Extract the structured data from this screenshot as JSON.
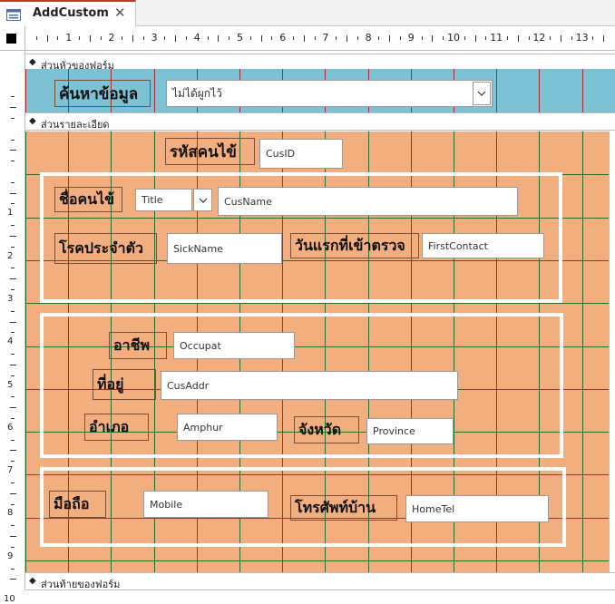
{
  "tab": {
    "title": "AddCustom",
    "close_glyph": "✕",
    "icon": "form-icon"
  },
  "ruler": {
    "h_numbers": [
      "1",
      "2",
      "3",
      "4",
      "5",
      "6",
      "7",
      "8",
      "9",
      "10",
      "11",
      "12",
      "13"
    ],
    "v_numbers": [
      "1",
      "2",
      "3",
      "4",
      "5",
      "6",
      "7",
      "8",
      "9",
      "10"
    ]
  },
  "sections": {
    "header": "ส่วนหัวของฟอร์ม",
    "detail": "ส่วนรายละเอียด",
    "footer": "ส่วนท้ายของฟอร์ม"
  },
  "header_controls": {
    "search_label": "ค้นหาข้อมูล",
    "search_combo_value": "ไม่ได้ผูกไว้"
  },
  "detail_controls": {
    "cusid_label": "รหัสคนไข้",
    "cusid_field": "CusID",
    "name_label": "ชื่อคนไข้",
    "title_combo": "Title",
    "cusname_field": "CusName",
    "sick_label": "โรคประจำตัว",
    "sickname_field": "SickName",
    "firstdate_label": "วันแรกที่เข้าตรวจ",
    "firstcontact_field": "FirstContact",
    "occupation_label": "อาชีพ",
    "occupat_field": "Occupat",
    "address_label": "ที่อยู่",
    "cusaddr_field": "CusAddr",
    "amphur_label": "อำเภอ",
    "amphur_field": "Amphur",
    "province_label": "จังหวัด",
    "province_field": "Province",
    "mobile_label": "มือถือ",
    "mobile_field": "Mobile",
    "hometel_label": "โทรศัพท์บ้าน",
    "hometel_field": "HomeTel"
  },
  "colors": {
    "header_bg": "#7cc1d4",
    "detail_bg": "#f3ae80",
    "header_grid": "#b02a30",
    "detail_grid": "#2e6b2e",
    "tab_accent": "#c0392b"
  }
}
